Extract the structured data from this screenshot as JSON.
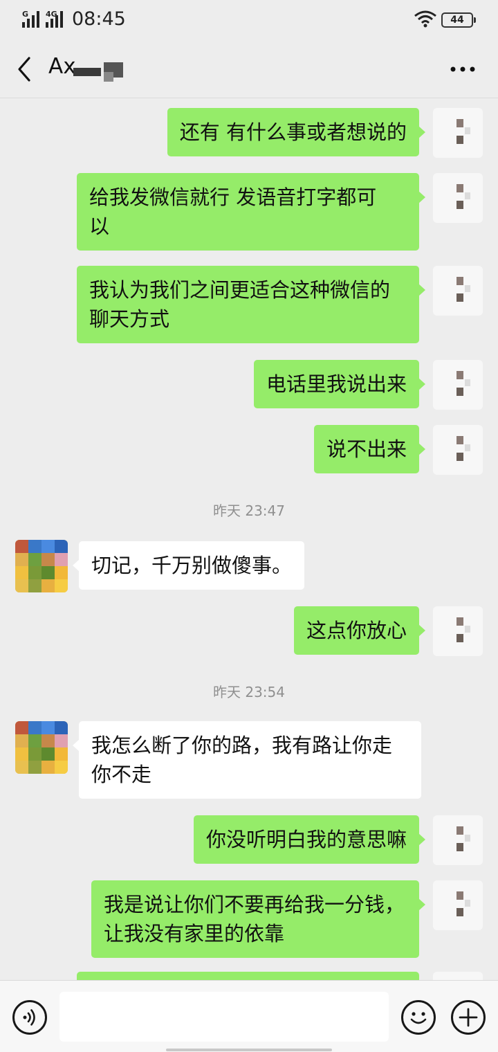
{
  "status": {
    "signal1_label": "G",
    "signal2_label": "4G",
    "time": "08:45",
    "battery": "44"
  },
  "header": {
    "title": "Ax"
  },
  "messages": [
    {
      "type": "out",
      "lines": [
        "还有  有什么事或者想说的"
      ]
    },
    {
      "type": "out",
      "lines": [
        "给我发微信就行   发语音打字都可",
        "以"
      ]
    },
    {
      "type": "out",
      "lines": [
        "我认为我们之间更适合这种微信的",
        "聊天方式"
      ]
    },
    {
      "type": "out",
      "lines": [
        "电话里我说出来"
      ]
    },
    {
      "type": "out",
      "lines": [
        "说不出来"
      ]
    },
    {
      "type": "time",
      "text": "昨天 23:47"
    },
    {
      "type": "in",
      "lines": [
        "切记，千万别做傻事。"
      ]
    },
    {
      "type": "out",
      "lines": [
        "这点你放心"
      ]
    },
    {
      "type": "time",
      "text": "昨天 23:54"
    },
    {
      "type": "in",
      "lines": [
        "我怎么断了你的路，我有路让你走",
        "你不走"
      ]
    },
    {
      "type": "out",
      "lines": [
        "你没听明白我的意思嘛"
      ]
    },
    {
      "type": "out",
      "lines": [
        "我是说让你们不要再给我一分钱，",
        "让我没有家里的依靠"
      ]
    }
  ],
  "input": {
    "value": ""
  },
  "icons": {
    "back": "back-arrow-icon",
    "more": "more-dots-icon",
    "voice": "voice-icon",
    "emoji": "emoji-icon",
    "plus": "plus-icon",
    "wifi": "wifi-icon"
  },
  "colors": {
    "outgoing_bubble": "#95ec69",
    "incoming_bubble": "#ffffff",
    "background": "#ededed",
    "timestamp": "#8f8f8f"
  }
}
